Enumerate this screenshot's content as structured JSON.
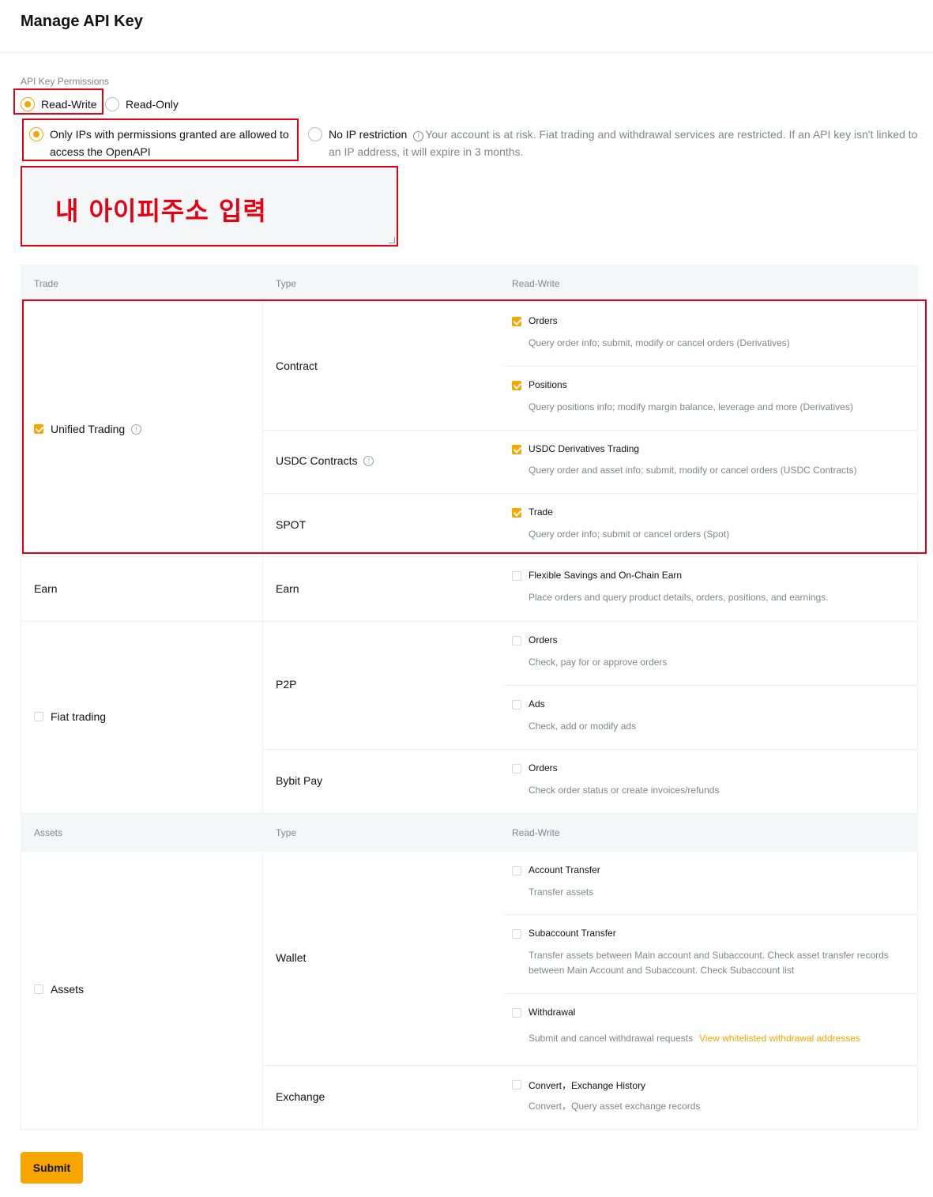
{
  "page": {
    "title": "Manage API Key"
  },
  "permissions": {
    "label": "API Key Permissions",
    "read_write": "Read-Write",
    "read_only": "Read-Only",
    "ip_restricted": "Only IPs with permissions granted are allowed to access the OpenAPI",
    "no_ip": "No IP restriction",
    "no_ip_warning": "Your account is at risk. Fiat trading and withdrawal services are restricted. If an API key isn't linked to an IP address, it will expire in 3 months.",
    "selected": "Read-Write",
    "ip_selected": "Only IPs with permissions granted are allowed to access the OpenAPI"
  },
  "ip_input": {
    "value": "내 아이피주소 입력"
  },
  "trade_table": {
    "headers": [
      "Trade",
      "Type",
      "Read-Write"
    ],
    "groups": [
      {
        "name": "Unified Trading",
        "checked": true,
        "info_icon": true
      },
      {
        "name": "Earn",
        "checked": false
      },
      {
        "name": "Fiat trading",
        "checked": false
      }
    ],
    "types": [
      "Contract",
      "USDC Contracts",
      "SPOT",
      "Earn",
      "P2P",
      "Bybit Pay"
    ],
    "permissions": [
      {
        "name": "Orders",
        "desc": "Query order info; submit, modify or cancel orders (Derivatives)",
        "checked": true
      },
      {
        "name": "Positions",
        "desc": "Query positions info; modify margin balance, leverage and more (Derivatives)",
        "checked": true
      },
      {
        "name": "USDC Derivatives Trading",
        "desc": "Query order and asset info; submit, modify or cancel orders (USDC Contracts)",
        "checked": true
      },
      {
        "name": "Trade",
        "desc": "Query order info; submit or cancel orders (Spot)",
        "checked": true
      },
      {
        "name": "Flexible Savings and On-Chain Earn",
        "desc": "Place orders and query product details, orders, positions, and earnings.",
        "checked": false
      },
      {
        "name": "Orders",
        "desc": "Check, pay for or approve orders",
        "checked": false
      },
      {
        "name": "Ads",
        "desc": "Check, add or modify ads",
        "checked": false
      },
      {
        "name": "Orders",
        "desc": "Check order status or create invoices/refunds",
        "checked": false
      }
    ]
  },
  "assets_table": {
    "headers": [
      "Assets",
      "Type",
      "Read-Write"
    ],
    "group": {
      "name": "Assets",
      "checked": false
    },
    "types": [
      "Wallet",
      "Exchange"
    ],
    "permissions": [
      {
        "name": "Account Transfer",
        "desc": "Transfer assets",
        "checked": false
      },
      {
        "name": "Subaccount Transfer",
        "desc": "Transfer assets between Main account and Subaccount. Check asset transfer records between Main Account and Subaccount. Check Subaccount list",
        "checked": false
      },
      {
        "name": "Withdrawal",
        "desc": "Submit and cancel withdrawal requests",
        "link": "View whitelisted withdrawal addresses",
        "checked": false
      },
      {
        "name": "Convert，Exchange History",
        "desc": "Convert，Query asset exchange records",
        "checked": false
      }
    ]
  },
  "submit": {
    "label": "Submit"
  },
  "colors": {
    "accent": "#f7a600",
    "annotation_red": "#e60012",
    "header_bg": "#f5f6f7"
  }
}
